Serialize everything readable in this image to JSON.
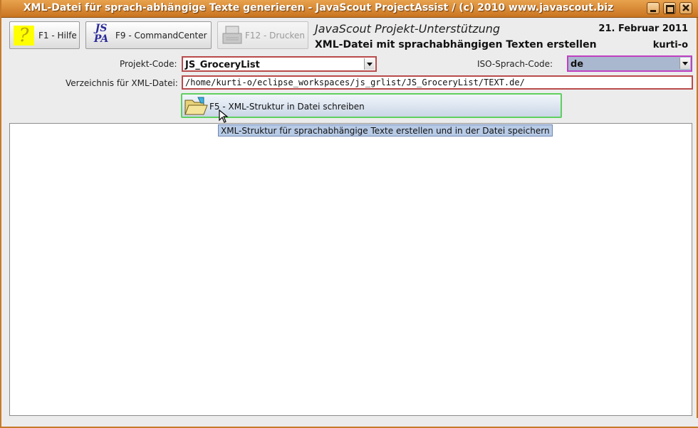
{
  "window": {
    "title": "XML-Datei für sprach-abhängige Texte generieren - JavaScout ProjectAssist / (c) 2010 www.javascout.biz"
  },
  "toolbar": {
    "help_label": "F1 - Hilfe",
    "commandcenter_label": "F9 - CommandCenter",
    "commandcenter_logo_top": "JS",
    "commandcenter_logo_bottom": "PA",
    "print_label": "F12 - Drucken"
  },
  "header": {
    "app_name": "JavaScout Projekt-Unterstützung",
    "subtitle": "XML-Datei mit sprachabhängigen Texten erstellen",
    "date": "21. Februar 2011",
    "user": "kurti-o"
  },
  "form": {
    "project_code_label": "Projekt-Code:",
    "project_code_value": "JS_GroceryList",
    "iso_code_label": "ISO-Sprach-Code:",
    "iso_code_value": "de",
    "directory_label": "Verzeichnis für XML-Datei:",
    "directory_value": "/home/kurti-o/eclipse_workspaces/js_grlist/JS_GroceryList/TEXT.de/"
  },
  "action": {
    "write_label": "F5 - XML-Struktur in Datei schreiben",
    "tooltip": "XML-Struktur für sprachabhängige Texte erstellen und in der Datei speichern"
  },
  "colors": {
    "title_bar": "#d98a35",
    "field_border_required": "#b94a4a",
    "iso_border": "#c040c0",
    "action_border": "#5fd05f"
  }
}
